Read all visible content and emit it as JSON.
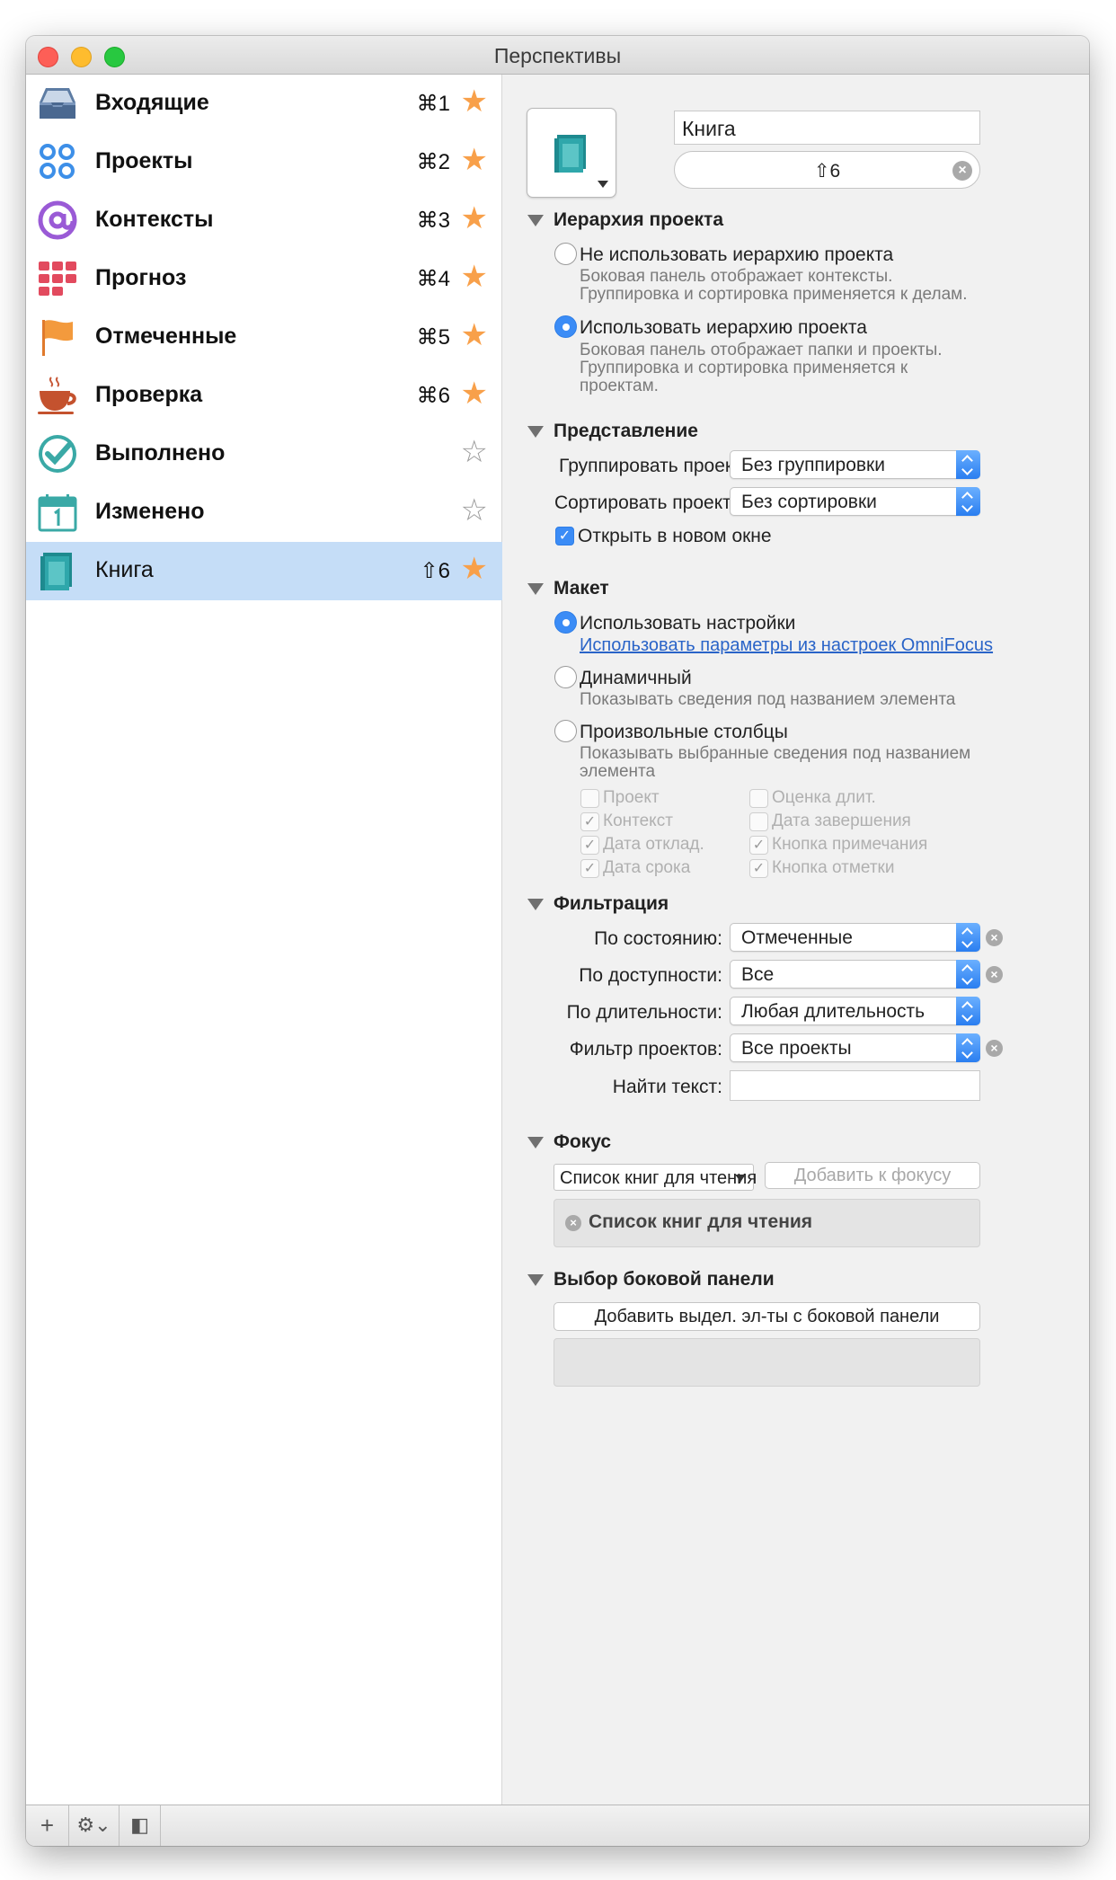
{
  "window": {
    "title": "Перспективы"
  },
  "sidebar": {
    "items": [
      {
        "label": "Входящие",
        "shortcut": "⌘1",
        "starred": true,
        "icon": "inbox-icon"
      },
      {
        "label": "Проекты",
        "shortcut": "⌘2",
        "starred": true,
        "icon": "projects-icon"
      },
      {
        "label": "Контексты",
        "shortcut": "⌘3",
        "starred": true,
        "icon": "contexts-icon"
      },
      {
        "label": "Прогноз",
        "shortcut": "⌘4",
        "starred": true,
        "icon": "forecast-icon"
      },
      {
        "label": "Отмеченные",
        "shortcut": "⌘5",
        "starred": true,
        "icon": "flag-icon"
      },
      {
        "label": "Проверка",
        "shortcut": "⌘6",
        "starred": true,
        "icon": "review-cup-icon"
      },
      {
        "label": "Выполнено",
        "shortcut": "",
        "starred": false,
        "icon": "completed-check-icon"
      },
      {
        "label": "Изменено",
        "shortcut": "",
        "starred": false,
        "icon": "calendar-icon"
      },
      {
        "label": "Книга",
        "shortcut": "⇧6",
        "starred": true,
        "icon": "book-icon",
        "selected": true
      }
    ],
    "star_on": "★",
    "star_off": "☆"
  },
  "bottom_bar": {
    "add": "+",
    "gear": "⚙⌄",
    "toggle": "◧"
  },
  "header": {
    "name_value": "Книга",
    "shortcut_value": "⇧6",
    "clear_glyph": "×",
    "icon": "book-icon"
  },
  "hierarchy": {
    "title": "Иерархия проекта",
    "opt1_label": "Не использовать иерархию проекта",
    "opt1_desc1": "Боковая панель отображает контексты.",
    "opt1_desc2": "Группировка и сортировка применяется к делам.",
    "opt2_label": "Использовать иерархию проекта",
    "opt2_desc1": "Боковая панель отображает папки и проекты.",
    "opt2_desc2": "Группировка и сортировка применяется к",
    "opt2_desc3": "проектам.",
    "selected": 2
  },
  "presentation": {
    "title": "Представление",
    "group_label": "Группировать проект...",
    "group_value": "Без группировки",
    "sort_label": "Сортировать проекты...",
    "sort_value": "Без сортировки",
    "open_new_window_label": "Открыть в новом окне",
    "open_new_window_checked": true,
    "check_glyph": "✓"
  },
  "layout": {
    "title": "Макет",
    "use_settings_label": "Использовать настройки",
    "use_settings_link": "Использовать параметры из настроек OmniFocus",
    "dynamic_label": "Динамичный",
    "dynamic_desc": "Показывать сведения под названием элемента",
    "custom_label": "Произвольные столбцы",
    "custom_desc1": "Показывать выбранные сведения под названием",
    "custom_desc2": "элемента",
    "columns": [
      {
        "label": "Проект",
        "checked": false
      },
      {
        "label": "Оценка длит.",
        "checked": false
      },
      {
        "label": "Контекст",
        "checked": true
      },
      {
        "label": "Дата завершения",
        "checked": false
      },
      {
        "label": "Дата отклад.",
        "checked": true
      },
      {
        "label": "Кнопка примечания",
        "checked": true
      },
      {
        "label": "Дата срока",
        "checked": true
      },
      {
        "label": "Кнопка отметки",
        "checked": true
      }
    ]
  },
  "filter": {
    "title": "Фильтрация",
    "state_label": "По состоянию:",
    "state_value": "Отмеченные",
    "availability_label": "По доступности:",
    "availability_value": "Все",
    "duration_label": "По длительности:",
    "duration_value": "Любая длительность",
    "projects_label": "Фильтр проектов:",
    "projects_value": "Все проекты",
    "find_label": "Найти текст:",
    "find_value": ""
  },
  "focus": {
    "title": "Фокус",
    "select_value": "Список книг для чтения",
    "add_button": "Добавить к фокусу",
    "item_label": "Список книг для чтения"
  },
  "sidebar_selection": {
    "title": "Выбор боковой панели",
    "add_button": "Добавить выдел. эл-ты с боковой панели"
  },
  "colors": {
    "accent": "#3b8cf6",
    "star": "#f8a04a",
    "selection": "#c5ddf7"
  }
}
